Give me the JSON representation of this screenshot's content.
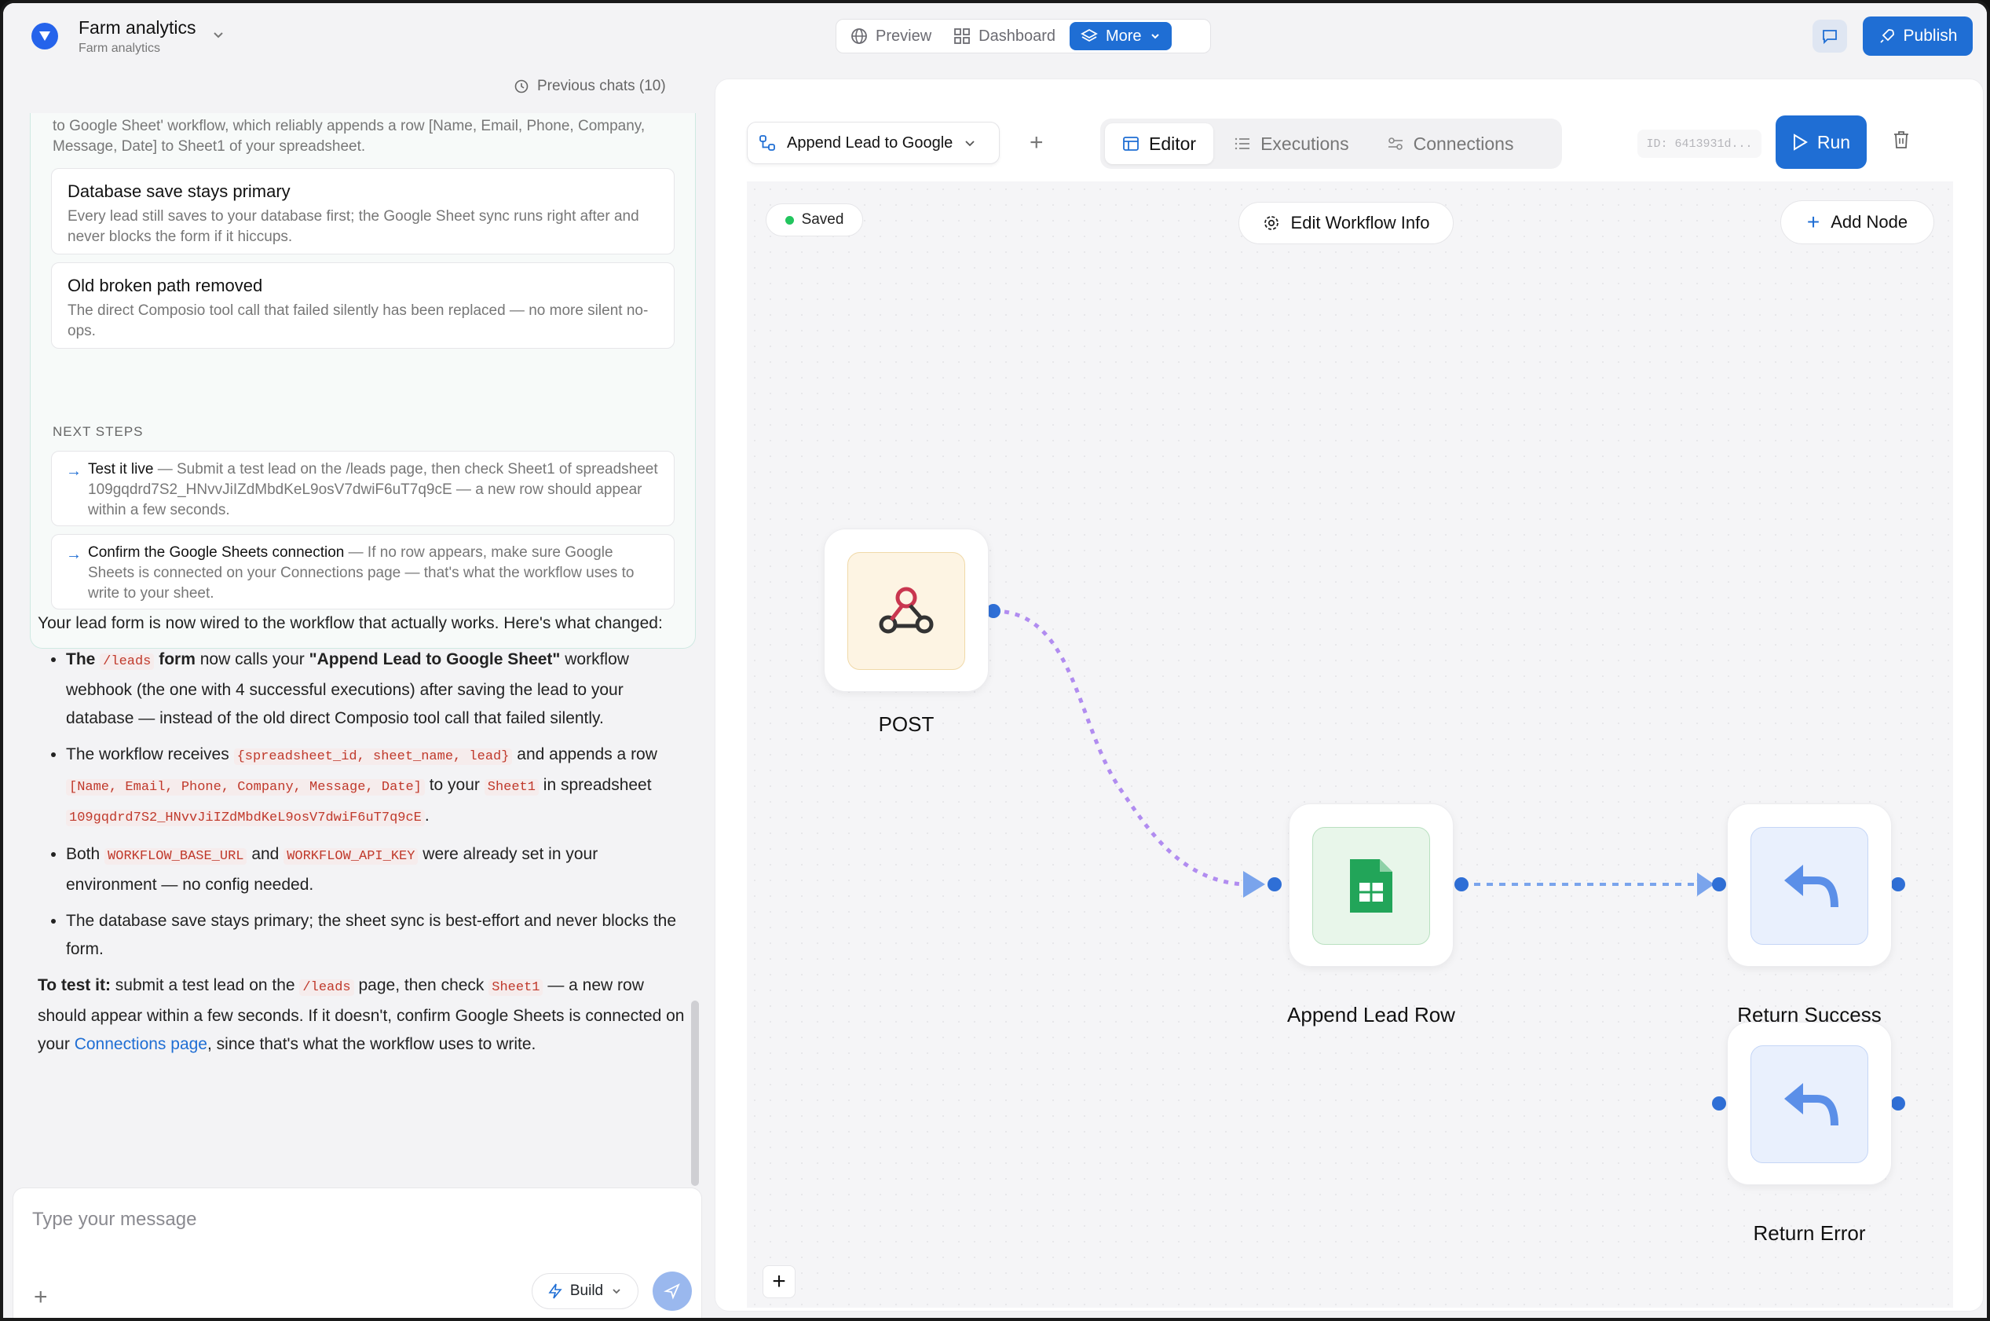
{
  "header": {
    "app_title": "Farm analytics",
    "app_subtitle": "Farm analytics",
    "tabs": [
      {
        "label": "Preview",
        "icon": "globe-icon"
      },
      {
        "label": "Dashboard",
        "icon": "grid-icon"
      },
      {
        "label": "More",
        "icon": "layers-icon"
      }
    ],
    "publish_label": "Publish"
  },
  "chat": {
    "previous_chats": "Previous chats (10)",
    "truncated_text": "to Google Sheet' workflow, which reliably appends a row [Name, Email, Phone, Company, Message, Date] to Sheet1 of your spreadsheet.",
    "items": [
      {
        "title": "Database save stays primary",
        "body": "Every lead still saves to your database first; the Google Sheet sync runs right after and never blocks the form if it hiccups."
      },
      {
        "title": "Old broken path removed",
        "body": "The direct Composio tool call that failed silently has been replaced — no more silent no-ops."
      }
    ],
    "next_steps_label": "NEXT STEPS",
    "steps": [
      {
        "title": "Test it live",
        "body": " — Submit a test lead on the /leads page, then check Sheet1 of spreadsheet 109gqdrd7S2_HNvvJiIZdMbdKeL9osV7dwiF6uT7q9cE — a new row should appear within a few seconds."
      },
      {
        "title": "Confirm the Google Sheets connection",
        "body": " — If no row appears, make sure Google Sheets is connected on your Connections page — that's what the workflow uses to write to your sheet."
      }
    ],
    "message": {
      "intro": "Your lead form is now wired to the workflow that actually works. Here's what changed:",
      "b1_a": "The ",
      "b1_code": "/leads",
      "b1_b": " form",
      "b1_c": " now calls your ",
      "b1_d": "\"Append Lead to Google Sheet\"",
      "b1_e": " workflow webhook (the one with 4 successful executions) after saving the lead to your database — instead of the old direct Composio tool call that failed silently.",
      "b2_a": "The workflow receives ",
      "b2_code1": "{spreadsheet_id, sheet_name, lead}",
      "b2_b": " and appends a row ",
      "b2_code2": "[Name, Email, Phone, Company, Message, Date]",
      "b2_c": " to your ",
      "b2_code3": "Sheet1",
      "b2_d": " in spreadsheet ",
      "b2_code4": "109gqdrd7S2_HNvvJiIZdMbdKeL9osV7dwiF6uT7q9cE",
      "b2_e": ".",
      "b3_a": "Both ",
      "b3_code1": "WORKFLOW_BASE_URL",
      "b3_b": " and ",
      "b3_code2": "WORKFLOW_API_KEY",
      "b3_c": " were already set in your environment — no config needed.",
      "b4": "The database save stays primary; the sheet sync is best-effort and never blocks the form.",
      "t_a": "To test it:",
      "t_b": " submit a test lead on the ",
      "t_code1": "/leads",
      "t_c": " page, then check ",
      "t_code2": "Sheet1",
      "t_d": " — a new row should appear within a few seconds. If it doesn't, confirm Google Sheets is connected on your ",
      "t_link": "Connections page",
      "t_e": ", since that's what the workflow uses to write."
    },
    "composer_placeholder": "Type your message",
    "build_label": "Build"
  },
  "workflow": {
    "selected_workflow": "Append Lead to Google",
    "tabs": [
      {
        "label": "Editor",
        "active": true
      },
      {
        "label": "Executions",
        "active": false
      },
      {
        "label": "Connections",
        "active": false
      }
    ],
    "id_label": "ID: 6413931d...",
    "run_label": "Run",
    "saved_label": "Saved",
    "edit_info_label": "Edit Workflow Info",
    "add_node_label": "Add Node",
    "nodes": [
      {
        "label": "POST",
        "icon": "webhook-icon",
        "color": "#fdf4e3"
      },
      {
        "label": "Append Lead Row",
        "icon": "google-sheets-icon",
        "color": "#e8f6ea"
      },
      {
        "label": "Return Success",
        "icon": "reply-icon",
        "color": "#e9f0fd"
      },
      {
        "label": "Return Error",
        "icon": "reply-icon",
        "color": "#e9f0fd"
      }
    ]
  },
  "colors": {
    "accent": "#1f6ed4",
    "edge_purple": "#b18cf0",
    "edge_blue": "#7aa4ec",
    "saved_green": "#22c55e"
  }
}
